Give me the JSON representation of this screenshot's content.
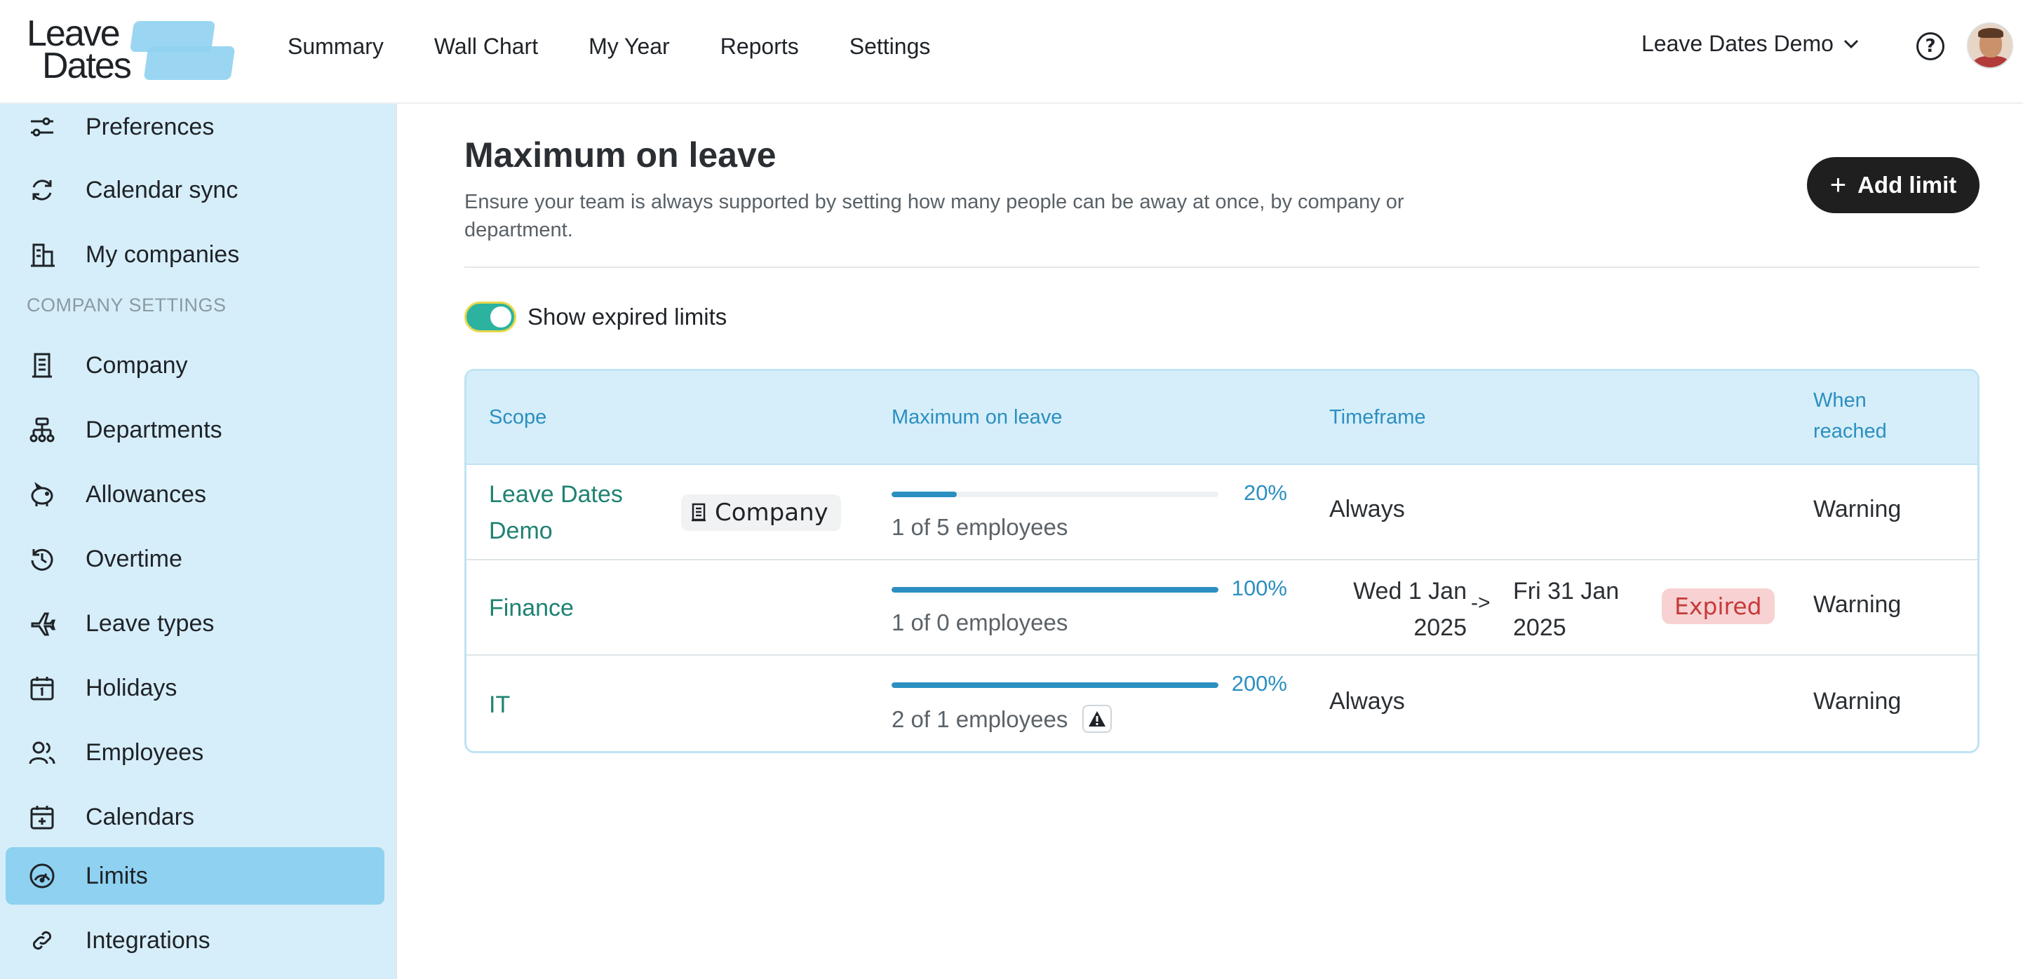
{
  "brand": {
    "line1": "Leave",
    "line2": "Dates",
    "accent": "#8fd2ef"
  },
  "nav": [
    "Summary",
    "Wall Chart",
    "My Year",
    "Reports",
    "Settings"
  ],
  "org": {
    "name": "Leave Dates Demo",
    "chevron": "chevron-down-icon"
  },
  "sidebar": {
    "items_top": [
      {
        "label": "Preferences",
        "icon": "sliders-icon"
      },
      {
        "label": "Calendar sync",
        "icon": "sync-icon"
      },
      {
        "label": "My companies",
        "icon": "buildings-icon"
      }
    ],
    "section_header": "COMPANY SETTINGS",
    "items": [
      {
        "label": "Company",
        "icon": "building-icon"
      },
      {
        "label": "Departments",
        "icon": "hierarchy-icon"
      },
      {
        "label": "Allowances",
        "icon": "piggy-bank-icon"
      },
      {
        "label": "Overtime",
        "icon": "clock-rotate-icon"
      },
      {
        "label": "Leave types",
        "icon": "plane-icon"
      },
      {
        "label": "Holidays",
        "icon": "calendar-day-icon"
      },
      {
        "label": "Employees",
        "icon": "users-icon"
      },
      {
        "label": "Calendars",
        "icon": "calendar-plus-icon"
      },
      {
        "label": "Limits",
        "icon": "gauge-icon",
        "active": true
      },
      {
        "label": "Integrations",
        "icon": "link-icon"
      }
    ]
  },
  "page": {
    "title": "Maximum on leave",
    "description": "Ensure your team is always supported by setting how many people can be away at once, by company or department.",
    "add_button": "Add limit",
    "toggle_label": "Show expired limits",
    "toggle_on": true
  },
  "table": {
    "headers": {
      "scope": "Scope",
      "max": "Maximum on leave",
      "timeframe": "Timeframe",
      "when": "When reached"
    },
    "rows": [
      {
        "scope": "Leave Dates Demo",
        "badge": "Company",
        "percent": "20%",
        "fill": 0.2,
        "count": "1 of 5 employees",
        "timeframe": "Always",
        "when": "Warning"
      },
      {
        "scope": "Finance",
        "percent": "100%",
        "fill": 1.0,
        "count": "1 of 0 employees",
        "from": "Wed 1 Jan 2025",
        "arrow": "->",
        "to": "Fri 31 Jan 2025",
        "status": "Expired",
        "when": "Warning"
      },
      {
        "scope": "IT",
        "percent": "200%",
        "fill": 1.0,
        "count": "2 of 1 employees",
        "warning_icon": "warning-triangle-icon",
        "timeframe": "Always",
        "when": "Warning"
      }
    ]
  }
}
